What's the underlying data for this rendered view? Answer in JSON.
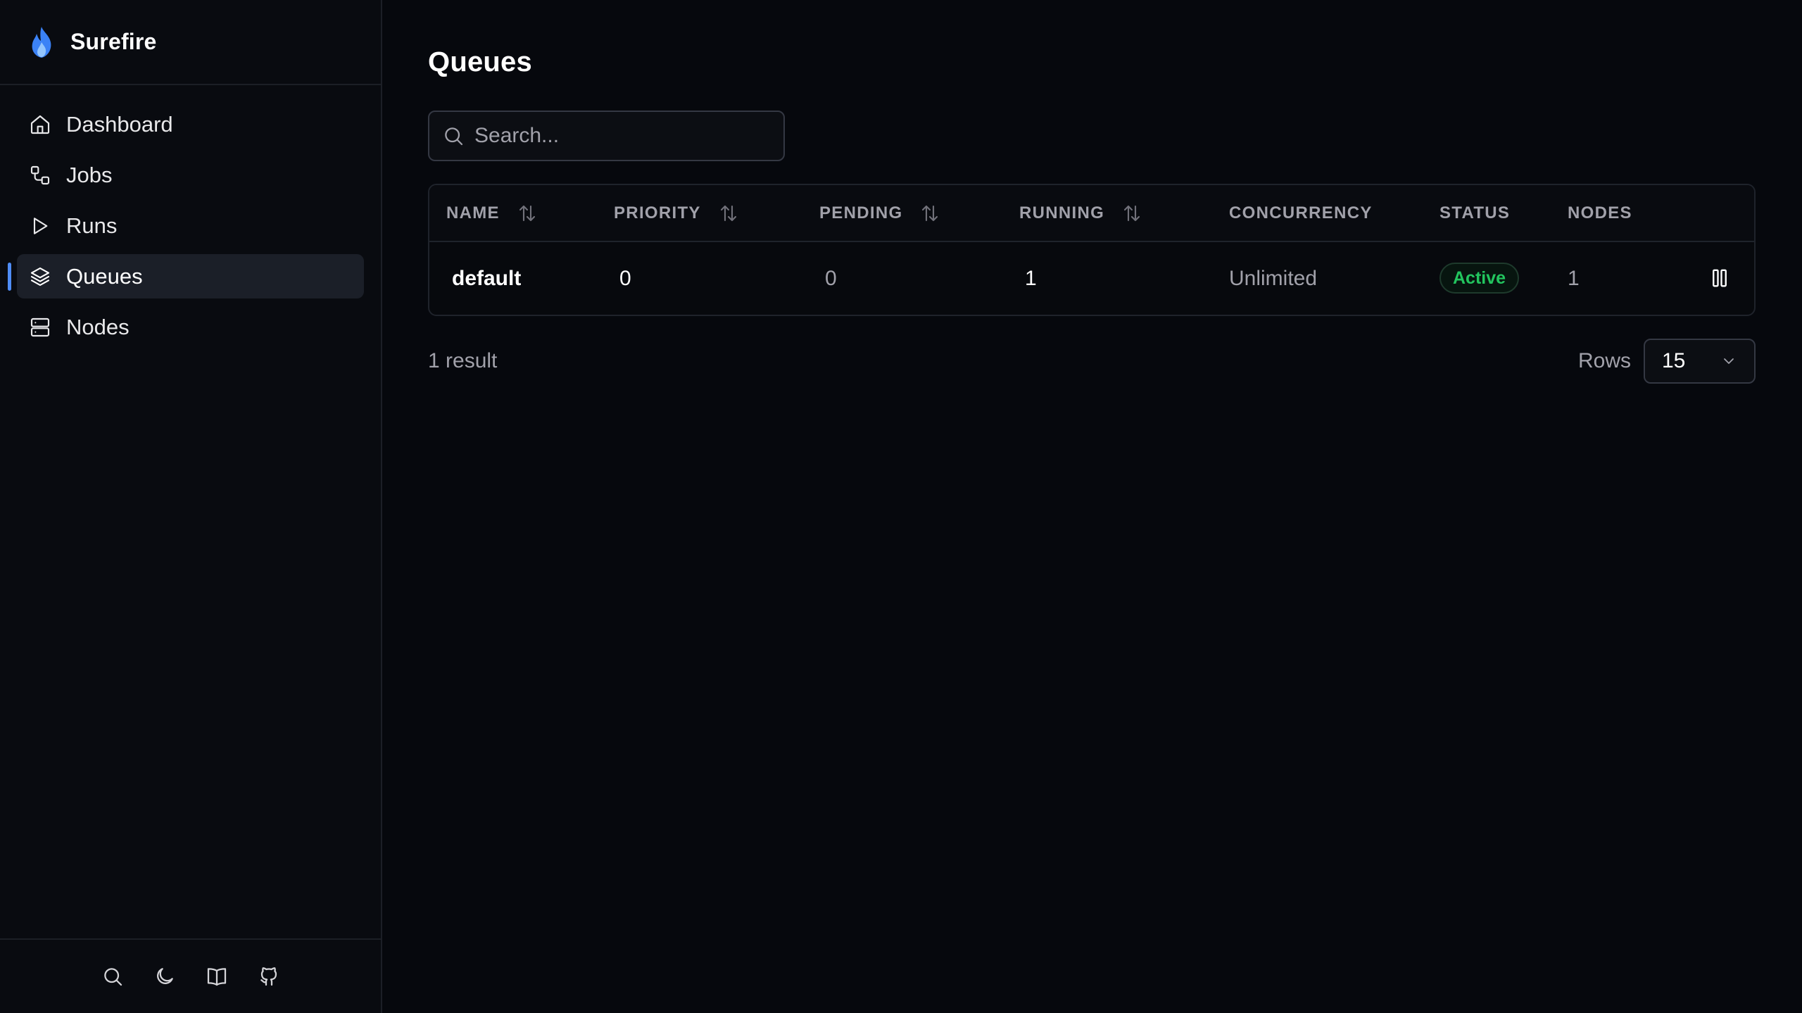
{
  "brand": {
    "name": "Surefire",
    "accent": "#4f8df7"
  },
  "sidebar": {
    "items": [
      {
        "label": "Dashboard",
        "icon": "home-icon",
        "active": false
      },
      {
        "label": "Jobs",
        "icon": "workflow-icon",
        "active": false
      },
      {
        "label": "Runs",
        "icon": "play-icon",
        "active": false
      },
      {
        "label": "Queues",
        "icon": "layers-icon",
        "active": true
      },
      {
        "label": "Nodes",
        "icon": "server-icon",
        "active": false
      }
    ],
    "footer_icons": [
      "search-icon",
      "moon-icon",
      "book-icon",
      "github-icon"
    ]
  },
  "main": {
    "title": "Queues",
    "search": {
      "placeholder": "Search...",
      "value": ""
    }
  },
  "table": {
    "columns": [
      {
        "label": "NAME",
        "sortable": true
      },
      {
        "label": "PRIORITY",
        "sortable": true
      },
      {
        "label": "PENDING",
        "sortable": true
      },
      {
        "label": "RUNNING",
        "sortable": true
      },
      {
        "label": "CONCURRENCY",
        "sortable": false
      },
      {
        "label": "STATUS",
        "sortable": false
      },
      {
        "label": "NODES",
        "sortable": false
      }
    ],
    "rows": [
      {
        "name": "default",
        "priority": "0",
        "pending": "0",
        "running": "1",
        "concurrency": "Unlimited",
        "status": "Active",
        "nodes": "1",
        "status_color": "#22c55e"
      }
    ]
  },
  "footer": {
    "result_count": "1 result",
    "rows_label": "Rows",
    "rows_value": "15"
  }
}
